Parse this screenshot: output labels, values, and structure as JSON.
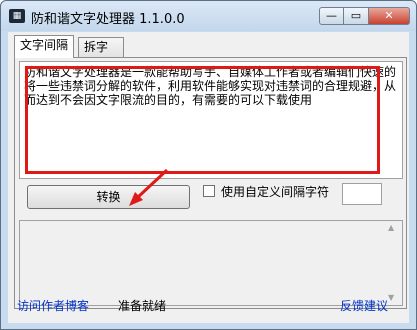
{
  "window": {
    "title": "防和谐文字处理器 1.1.0.0",
    "icon": "app-icon",
    "controls": {
      "minimize": "—",
      "maximize": "▭",
      "close": "✕"
    }
  },
  "tabs": [
    {
      "label": "文字间隔",
      "active": true
    },
    {
      "label": "拆字",
      "active": false
    }
  ],
  "main": {
    "input_text": "防和谐文字处理器是一款能帮助写手、自媒体工作者或者编辑们快速的将一些违禁词分解的软件，利用软件能够实现对违禁词的合理规避，从而达到不会因文字限流的目的，有需要的可以下载使用",
    "convert_label": "转换",
    "custom_separator_label": "使用自定义间隔字符",
    "custom_separator_checked": false,
    "custom_separator_value": ""
  },
  "footer": {
    "blog_link": "访问作者博客",
    "status": "准备就绪",
    "feedback_link": "反馈建议"
  },
  "colors": {
    "highlight": "#e01818",
    "link": "#0033cc",
    "window_frame": "#c9dcef"
  }
}
